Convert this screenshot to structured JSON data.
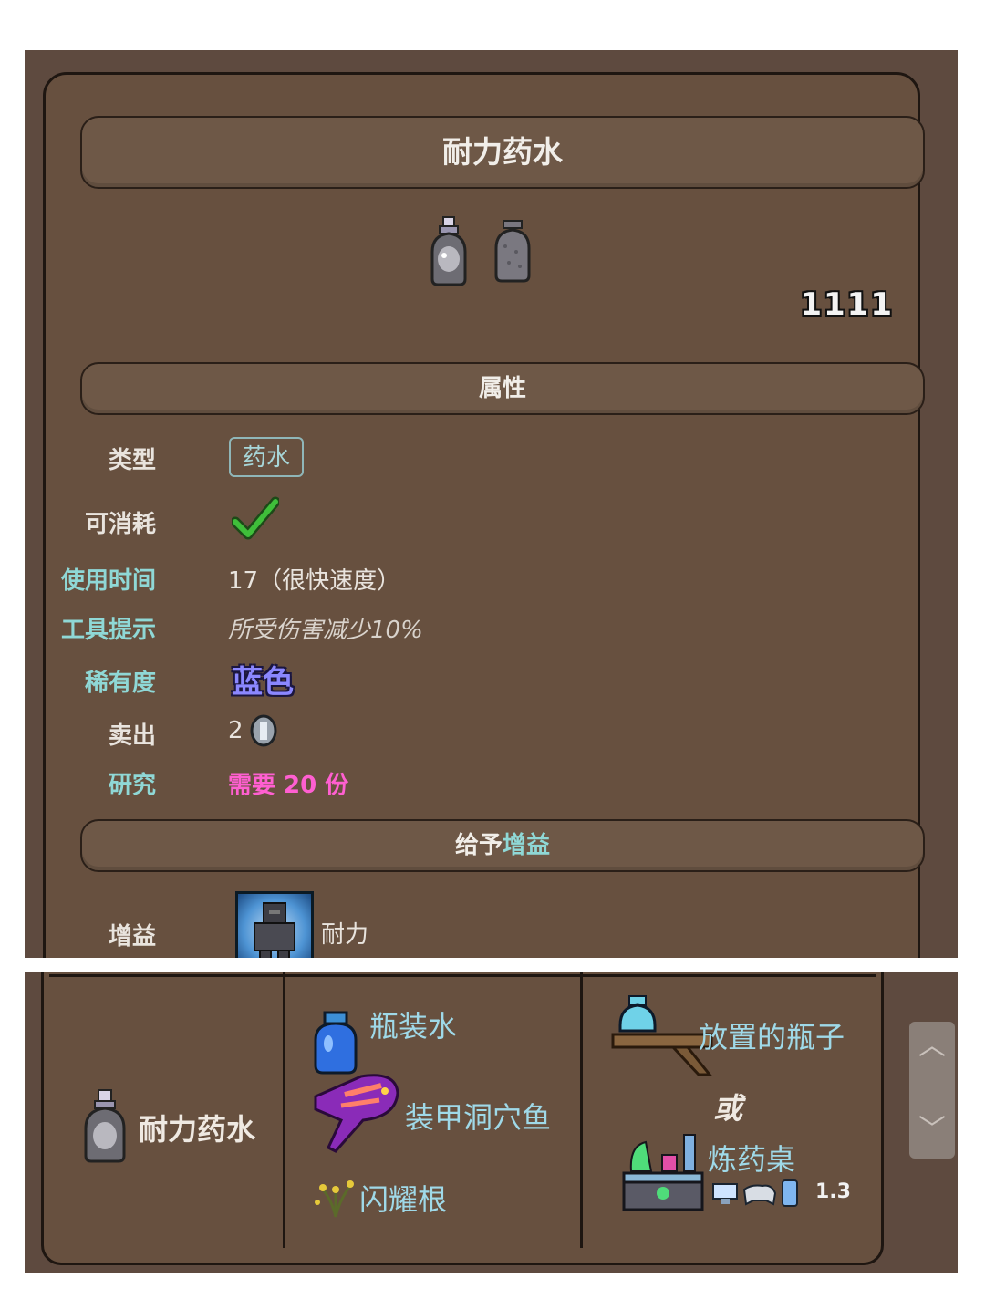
{
  "item": {
    "title": "耐力药水",
    "count": "1111",
    "attributes_heading": "属性",
    "type_label": "类型",
    "type_value": "药水",
    "consumable_label": "可消耗",
    "use_time_label": "使用时间",
    "use_time_value": "17（很快速度）",
    "tooltip_label": "工具提示",
    "tooltip_value": "所受伤害减少10%",
    "rarity_label": "稀有度",
    "rarity_value": "蓝色",
    "sell_label": "卖出",
    "sell_value": "2",
    "research_label": "研究",
    "research_value": "需要 20 份",
    "buff_heading_prefix": "给予",
    "buff_heading_highlight": "增益",
    "buff_label": "增益",
    "buff_name": "耐力"
  },
  "recipe": {
    "product": "耐力药水",
    "ingredients": [
      "瓶装水",
      "装甲洞穴鱼",
      "闪耀根"
    ],
    "stations": [
      "放置的瓶子",
      "炼药桌"
    ],
    "or_text": "或",
    "version": "1.3"
  },
  "icons": {
    "item": "potion-bottle-icon",
    "consumable": "checkmark-icon",
    "coin": "silver-coin-icon",
    "buff": "endurance-buff-icon",
    "scroll_up": "chevron-up-icon",
    "scroll_down": "chevron-down-icon"
  },
  "colors": {
    "panel": "#5e4a3f",
    "label_cyan": "#8fd8d6",
    "rarity_blue": "#8b87ff",
    "research_pink": "#ff5fd1",
    "check_green": "#3fbf3a"
  }
}
